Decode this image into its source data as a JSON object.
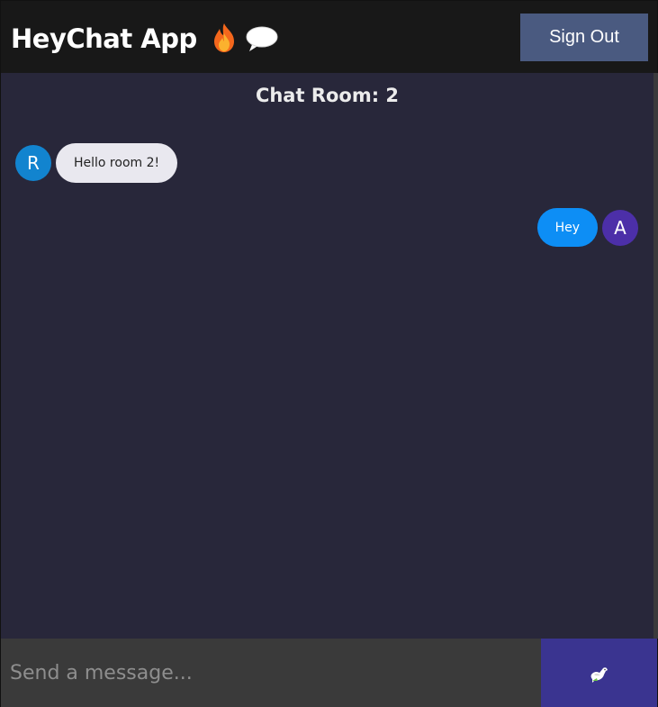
{
  "header": {
    "app_title": "HeyChat App",
    "icons": [
      "flame-icon",
      "speech-bubble-icon"
    ],
    "sign_out_label": "Sign Out"
  },
  "room": {
    "title": "Chat Room: 2"
  },
  "messages": [
    {
      "author_initial": "R",
      "text": "Hello room 2!",
      "direction": "received",
      "avatar_color": "#1284cf",
      "bubble_color": "#e9e8ef"
    },
    {
      "author_initial": "A",
      "text": "Hey",
      "direction": "sent",
      "avatar_color": "#4c2fa8",
      "bubble_color": "#0d8ef5"
    }
  ],
  "composer": {
    "placeholder": "Send a message...",
    "value": "",
    "send_icon": "dove-icon"
  },
  "colors": {
    "header_bg": "#181818",
    "chat_bg": "#28273a",
    "sign_out_bg": "#4a5a80",
    "send_bg": "#3a3490",
    "composer_bg": "#3a3a3a"
  }
}
